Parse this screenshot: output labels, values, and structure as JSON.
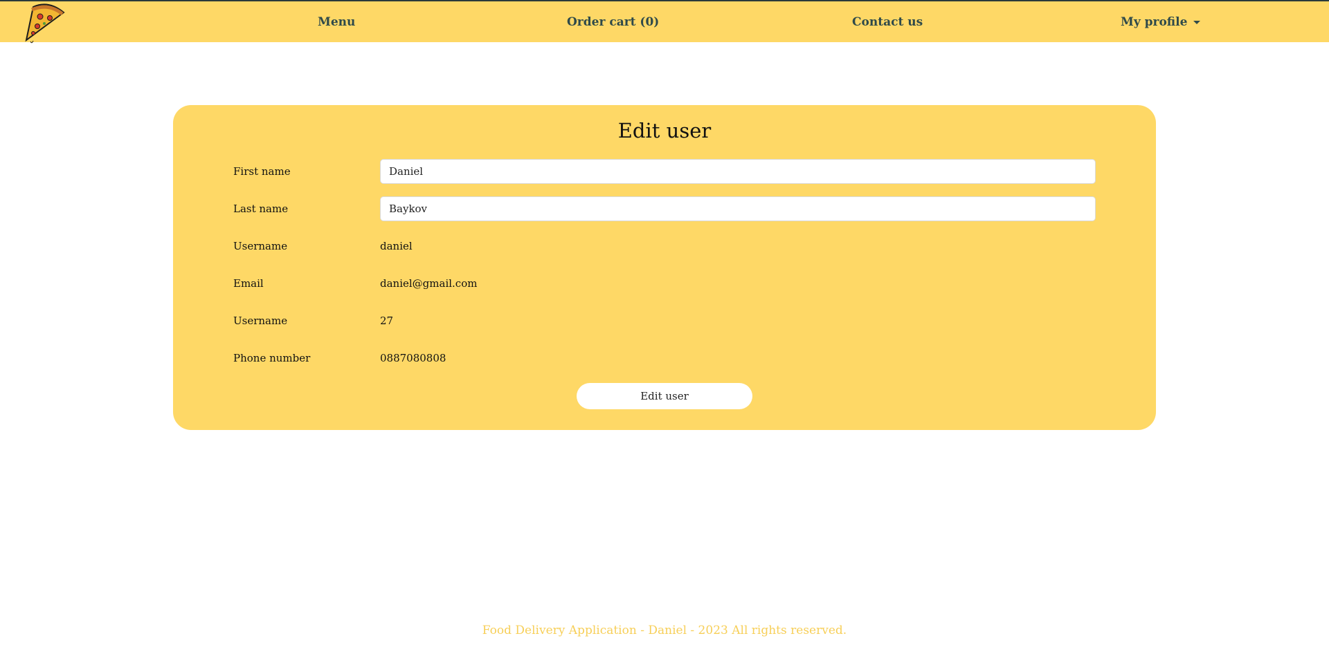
{
  "nav": {
    "menu": "Menu",
    "cart": "Order cart (0)",
    "contact": "Contact us",
    "profile": "My profile"
  },
  "form": {
    "title": "Edit user",
    "first_name": {
      "label": "First name",
      "value": "Daniel"
    },
    "last_name": {
      "label": "Last name",
      "value": "Baykov"
    },
    "username": {
      "label": "Username",
      "value": "daniel"
    },
    "email": {
      "label": "Email",
      "value": "daniel@gmail.com"
    },
    "age": {
      "label": "Username",
      "value": "27"
    },
    "phone": {
      "label": "Phone number",
      "value": "0887080808"
    },
    "submit": "Edit user"
  },
  "footer": {
    "text": "Food Delivery Application - Daniel - 2023 All rights reserved."
  },
  "icons": {
    "logo": "pizza-slice-icon",
    "dropdown": "caret-down-icon"
  },
  "colors": {
    "accent": "#fed866",
    "nav_text": "#2f4a4a",
    "footer_text": "#f7cf58"
  }
}
